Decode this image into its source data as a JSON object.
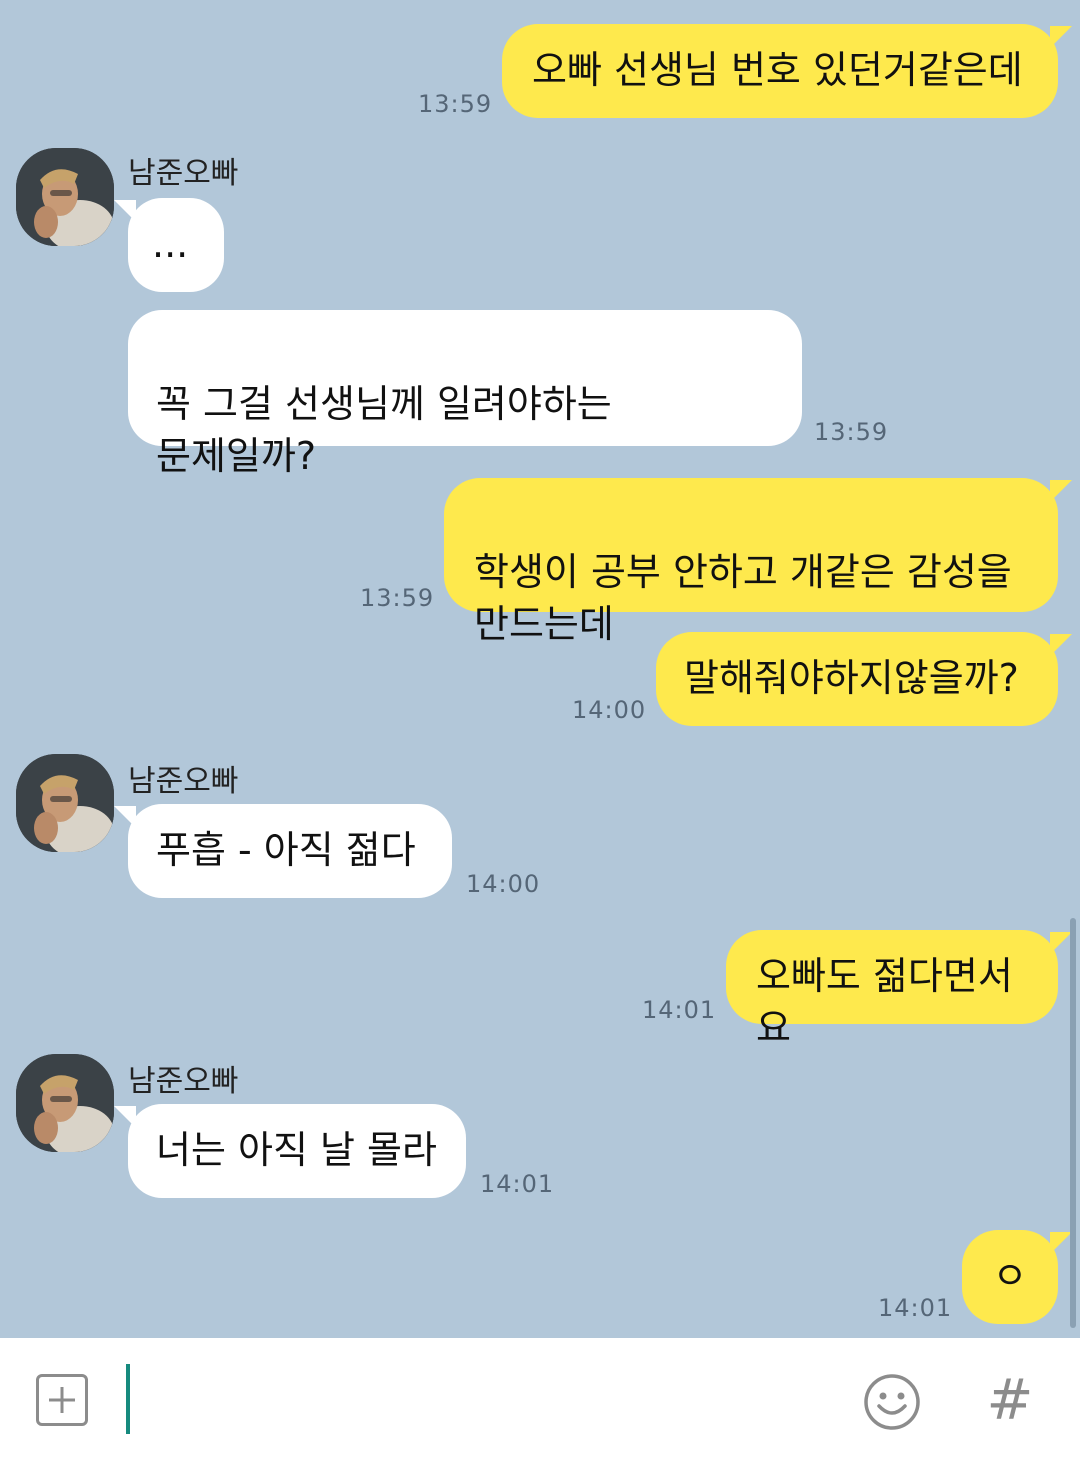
{
  "contact": {
    "name": "남준오빠"
  },
  "messages": [
    {
      "id": 1,
      "from": "me",
      "text": "오빠 선생님 번호 있던거같은데",
      "time": "13:59"
    },
    {
      "id": 2,
      "from": "them",
      "text": "...",
      "time": ""
    },
    {
      "id": 3,
      "from": "them",
      "text": "꼭 그걸 선생님께 일려야하는\n문제일까?",
      "time": "13:59"
    },
    {
      "id": 4,
      "from": "me",
      "text": "학생이 공부 안하고 개같은 감성을\n만드는데",
      "time": "13:59"
    },
    {
      "id": 5,
      "from": "me",
      "text": "말해줘야하지않을까?",
      "time": "14:00"
    },
    {
      "id": 6,
      "from": "them",
      "text": "푸흡 - 아직 젊다",
      "time": "14:00"
    },
    {
      "id": 7,
      "from": "me",
      "text": "오빠도 젊다면서요",
      "time": "14:01"
    },
    {
      "id": 8,
      "from": "them",
      "text": "너는 아직 날 몰라",
      "time": "14:01"
    },
    {
      "id": 9,
      "from": "me",
      "text": "ㅇ",
      "time": "14:01"
    }
  ],
  "composer": {
    "input_value": "",
    "hash_label": "#"
  },
  "icons": {
    "add": "plus-square-icon",
    "emoji": "smiley-icon",
    "hashtag": "hash-icon"
  },
  "colors": {
    "background": "#b2c7d9",
    "my_bubble": "#fee94d",
    "their_bubble": "#ffffff",
    "cursor": "#168a7e"
  }
}
